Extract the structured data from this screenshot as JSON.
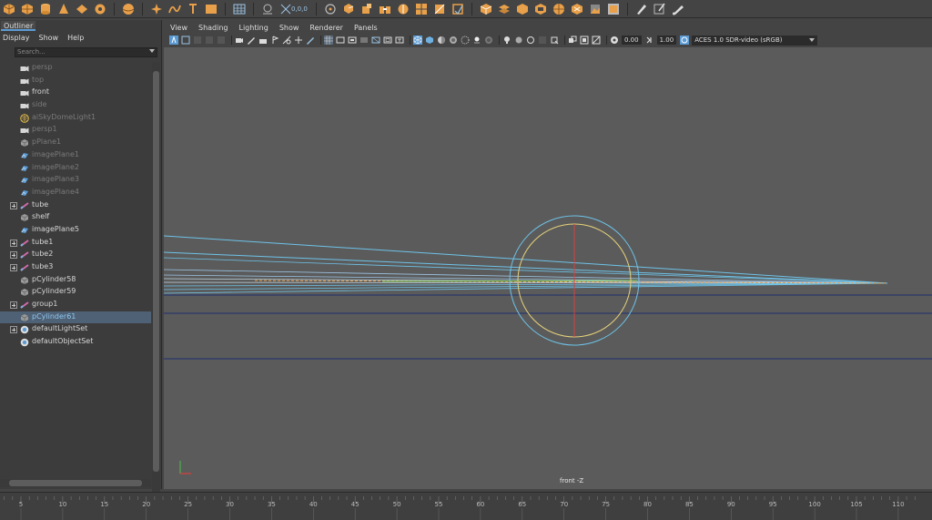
{
  "shelf": {
    "coord_readout": "0,0,0"
  },
  "outliner": {
    "tab_label": "Outliner",
    "menu": [
      "Display",
      "Show",
      "Help"
    ],
    "search_placeholder": "Search...",
    "items": [
      {
        "label": "persp",
        "icon": "camera-icon",
        "style": "dim",
        "expand": false
      },
      {
        "label": "top",
        "icon": "camera-icon",
        "style": "dim",
        "expand": false
      },
      {
        "label": "front",
        "icon": "camera-icon",
        "style": "normal",
        "expand": false
      },
      {
        "label": "side",
        "icon": "camera-icon",
        "style": "dim",
        "expand": false
      },
      {
        "label": "aiSkyDomeLight1",
        "icon": "skydome-light-icon",
        "style": "dim",
        "expand": false
      },
      {
        "label": "persp1",
        "icon": "camera-icon",
        "style": "dim",
        "expand": false
      },
      {
        "label": "pPlane1",
        "icon": "mesh-icon",
        "style": "dim",
        "expand": false
      },
      {
        "label": "imagePlane1",
        "icon": "image-plane-icon",
        "style": "dim",
        "expand": false
      },
      {
        "label": "imagePlane2",
        "icon": "image-plane-icon",
        "style": "dim",
        "expand": false
      },
      {
        "label": "imagePlane3",
        "icon": "image-plane-icon",
        "style": "dim",
        "expand": false
      },
      {
        "label": "imagePlane4",
        "icon": "image-plane-icon",
        "style": "dim",
        "expand": false
      },
      {
        "label": "tube",
        "icon": "curve-icon",
        "style": "normal",
        "expand": true
      },
      {
        "label": "shelf",
        "icon": "mesh-icon",
        "style": "normal",
        "expand": false
      },
      {
        "label": "imagePlane5",
        "icon": "image-plane-icon",
        "style": "normal",
        "expand": false
      },
      {
        "label": "tube1",
        "icon": "curve-icon",
        "style": "normal",
        "expand": true
      },
      {
        "label": "tube2",
        "icon": "curve-icon",
        "style": "normal",
        "expand": true
      },
      {
        "label": "tube3",
        "icon": "curve-icon",
        "style": "normal",
        "expand": true
      },
      {
        "label": "pCylinder58",
        "icon": "mesh-icon",
        "style": "normal",
        "expand": false
      },
      {
        "label": "pCylinder59",
        "icon": "mesh-icon",
        "style": "normal",
        "expand": false
      },
      {
        "label": "group1",
        "icon": "curve-icon",
        "style": "normal",
        "expand": true
      },
      {
        "label": "pCylinder61",
        "icon": "mesh-icon",
        "style": "selblue",
        "expand": false,
        "selected": true
      },
      {
        "label": "defaultLightSet",
        "icon": "set-icon",
        "style": "normal",
        "expand": true
      },
      {
        "label": "defaultObjectSet",
        "icon": "set-icon",
        "style": "normal",
        "expand": false
      }
    ]
  },
  "panel": {
    "menu": [
      "View",
      "Shading",
      "Lighting",
      "Show",
      "Renderer",
      "Panels"
    ],
    "exposure": "0.00",
    "gamma": "1.00",
    "colorspace": "ACES 1.0 SDR-video (sRGB)",
    "camera_label": "front -Z"
  },
  "timeslider": {
    "ticks": [
      "5",
      "10",
      "15",
      "20",
      "25",
      "30",
      "35",
      "40",
      "45",
      "50",
      "55",
      "60",
      "65",
      "70",
      "75",
      "80",
      "85",
      "90",
      "95",
      "100",
      "105",
      "110"
    ]
  },
  "colors": {
    "accent": "#e8a04a",
    "selection": "#4f6175",
    "wire_blue": "#6ec3e8",
    "wire_yellow": "#e6d27a",
    "wire_red": "#d94040",
    "grid_line": "#1f2f6e"
  }
}
